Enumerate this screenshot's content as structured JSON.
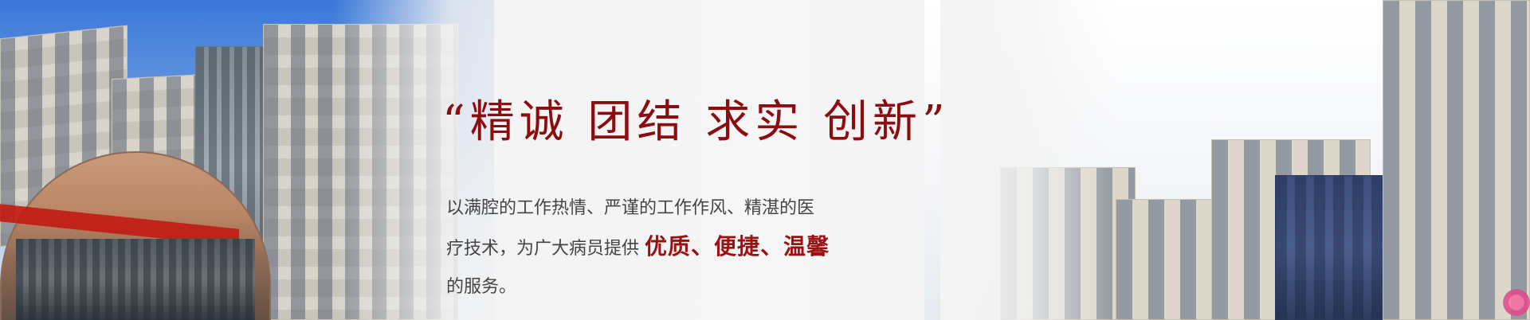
{
  "banner": {
    "slogan": "“精诚 团结 求实 创新”",
    "desc": {
      "line1": "以满腔的工作热情、严谨的工作作风、精湛的医",
      "line2_prefix": "疗技术，为广大病员提供 ",
      "line2_highlight": "优质、便捷、温馨",
      "line3": "的服务。"
    }
  }
}
